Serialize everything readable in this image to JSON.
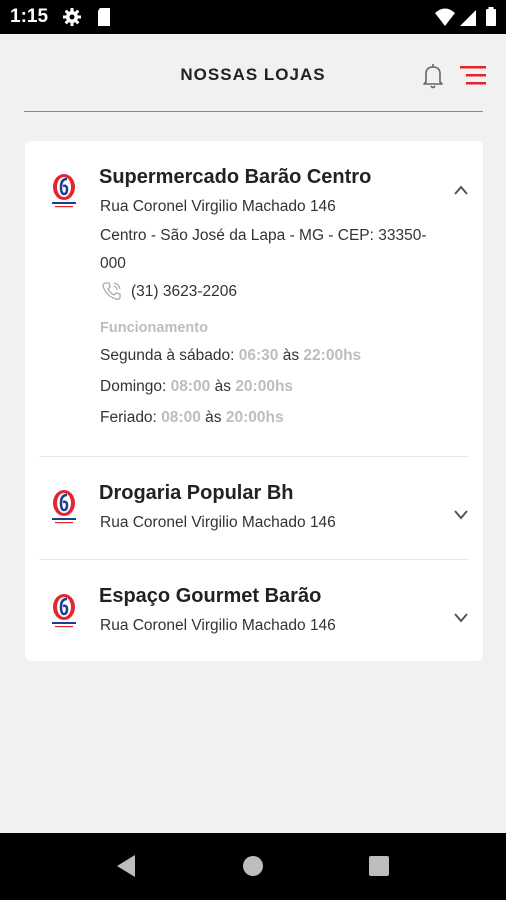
{
  "status_bar": {
    "time": "1:15"
  },
  "header": {
    "title": "NOSSAS LOJAS"
  },
  "stores": [
    {
      "name": "Supermercado Barão Centro",
      "street": "Rua Coronel Virgilio Machado 146",
      "city_line1": "Centro - São José da Lapa - MG - CEP: 33350-",
      "city_line2": "000",
      "phone": "(31) 3623-2206",
      "hours_title": "Funcionamento",
      "hours": [
        {
          "label": "Segunda à sábado:",
          "open": "06:30",
          "sep": "às",
          "close": "22:00hs"
        },
        {
          "label": "Domingo:",
          "open": "08:00",
          "sep": "às",
          "close": "20:00hs"
        },
        {
          "label": "Feriado:",
          "open": "08:00",
          "sep": "às",
          "close": "20:00hs"
        }
      ],
      "expanded": true
    },
    {
      "name": "Drogaria Popular Bh",
      "street": "Rua Coronel Virgilio Machado 146",
      "expanded": false
    },
    {
      "name": "Espaço Gourmet Barão",
      "street": "Rua Coronel Virgilio Machado 146",
      "expanded": false
    }
  ],
  "colors": {
    "accent": "#e3262d",
    "logo_blue": "#1e3e8f",
    "muted_text": "#bdbdbd"
  },
  "icons": [
    "settings-icon",
    "sim-card-icon",
    "wifi-icon",
    "signal-icon",
    "battery-icon",
    "bell-icon",
    "menu-icon",
    "phone-icon",
    "chevron-up-icon",
    "chevron-down-icon",
    "back-icon",
    "home-icon",
    "recents-icon"
  ]
}
